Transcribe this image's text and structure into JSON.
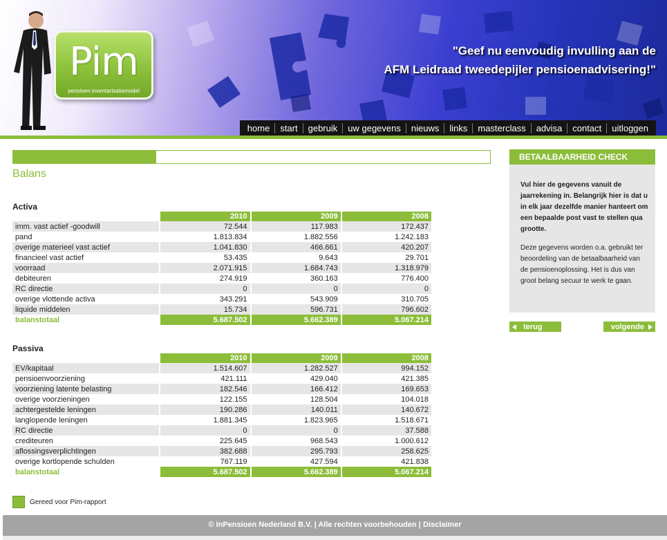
{
  "header": {
    "logo_word": "Pim",
    "logo_sub": "pensioen inventarisatiemodel",
    "slogan_line1": "\"Geef nu eenvoudig invulling aan de",
    "slogan_line2": "AFM Leidraad tweedepijler pensioenadvisering!\"",
    "nav": [
      "home",
      "start",
      "gebruik",
      "uw gegevens",
      "nieuws",
      "links",
      "masterclass",
      "advisa",
      "contact",
      "uitloggen"
    ]
  },
  "progress": {
    "fraction": 0.3
  },
  "page_title": "Balans",
  "years": [
    "2010",
    "2009",
    "2008"
  ],
  "activa": {
    "title": "Activa",
    "rows": [
      {
        "label": "imm. vast actief -goodwill",
        "values": [
          "72.544",
          "117.983",
          "172.437"
        ]
      },
      {
        "label": "pand",
        "values": [
          "1.813.834",
          "1.882.556",
          "1.242.183"
        ]
      },
      {
        "label": "overige materieel vast actief",
        "values": [
          "1.041.830",
          "466.661",
          "420.207"
        ]
      },
      {
        "label": "financieel vast actief",
        "values": [
          "53.435",
          "9.643",
          "29.701"
        ]
      },
      {
        "label": "voorraad",
        "values": [
          "2.071.915",
          "1.684.743",
          "1.318.979"
        ]
      },
      {
        "label": "debiteuren",
        "values": [
          "274.919",
          "360.163",
          "776.400"
        ]
      },
      {
        "label": "RC directie",
        "values": [
          "0",
          "0",
          "0"
        ]
      },
      {
        "label": "overige vlottende activa",
        "values": [
          "343.291",
          "543.909",
          "310.705"
        ]
      },
      {
        "label": "liquide middelen",
        "values": [
          "15.734",
          "596.731",
          "796.602"
        ]
      }
    ],
    "total": {
      "label": "balanstotaal",
      "values": [
        "5.687.502",
        "5.662.389",
        "5.067.214"
      ]
    }
  },
  "passiva": {
    "title": "Passiva",
    "rows": [
      {
        "label": "EV/kapitaal",
        "values": [
          "1.514.607",
          "1.282.527",
          "994.152"
        ]
      },
      {
        "label": "pensioenvoorziening",
        "values": [
          "421.111",
          "429.040",
          "421.385"
        ]
      },
      {
        "label": "voorziening latente belasting",
        "values": [
          "182.546",
          "166.412",
          "169.653"
        ]
      },
      {
        "label": "overige voorzieningen",
        "values": [
          "122.155",
          "128.504",
          "104.018"
        ]
      },
      {
        "label": "achtergestelde leningen",
        "values": [
          "190.286",
          "140.011",
          "140.672"
        ]
      },
      {
        "label": "langlopende leningen",
        "values": [
          "1.881.345",
          "1.823.965",
          "1.518.671"
        ]
      },
      {
        "label": "RC directie",
        "values": [
          "0",
          "0",
          "37.588"
        ]
      },
      {
        "label": "crediteuren",
        "values": [
          "225.645",
          "968.543",
          "1.000.612"
        ]
      },
      {
        "label": "aflossingsverplichtingen",
        "values": [
          "382.688",
          "295.793",
          "258.625"
        ]
      },
      {
        "label": "overige kortlopende schulden",
        "values": [
          "767.119",
          "427.594",
          "421.838"
        ]
      }
    ],
    "total": {
      "label": "balanstotaal",
      "values": [
        "5.687.502",
        "5.662.389",
        "5.067.214"
      ]
    }
  },
  "ready_label": "Gereed voor Pim-rapport",
  "sidebar": {
    "title": "BETAALBAARHEID CHECK",
    "para1": "Vul hier de gegevens vanuit de jaarrekening in. Belangrijk hier is dat u in elk jaar dezelfde manier hanteert om een bepaalde post vast te stellen qua grootte.",
    "para2": "Deze gegevens worden o.a. gebruikt ter beoordeling van de betaalbaarheid van de pensioenoplossing. Het is dus van groot belang secuur te werk te gaan.",
    "back_label": "terug",
    "next_label": "volgende"
  },
  "footer": {
    "copyright": "© InPensioen Nederland B.V.",
    "sep": " | ",
    "rights": "Alle rechten voorbehouden",
    "disclaimer": "Disclaimer"
  },
  "colors": {
    "accent": "#8cbd3a",
    "footer": "#a4a4a4",
    "row_alt": "#e6e6e6"
  }
}
